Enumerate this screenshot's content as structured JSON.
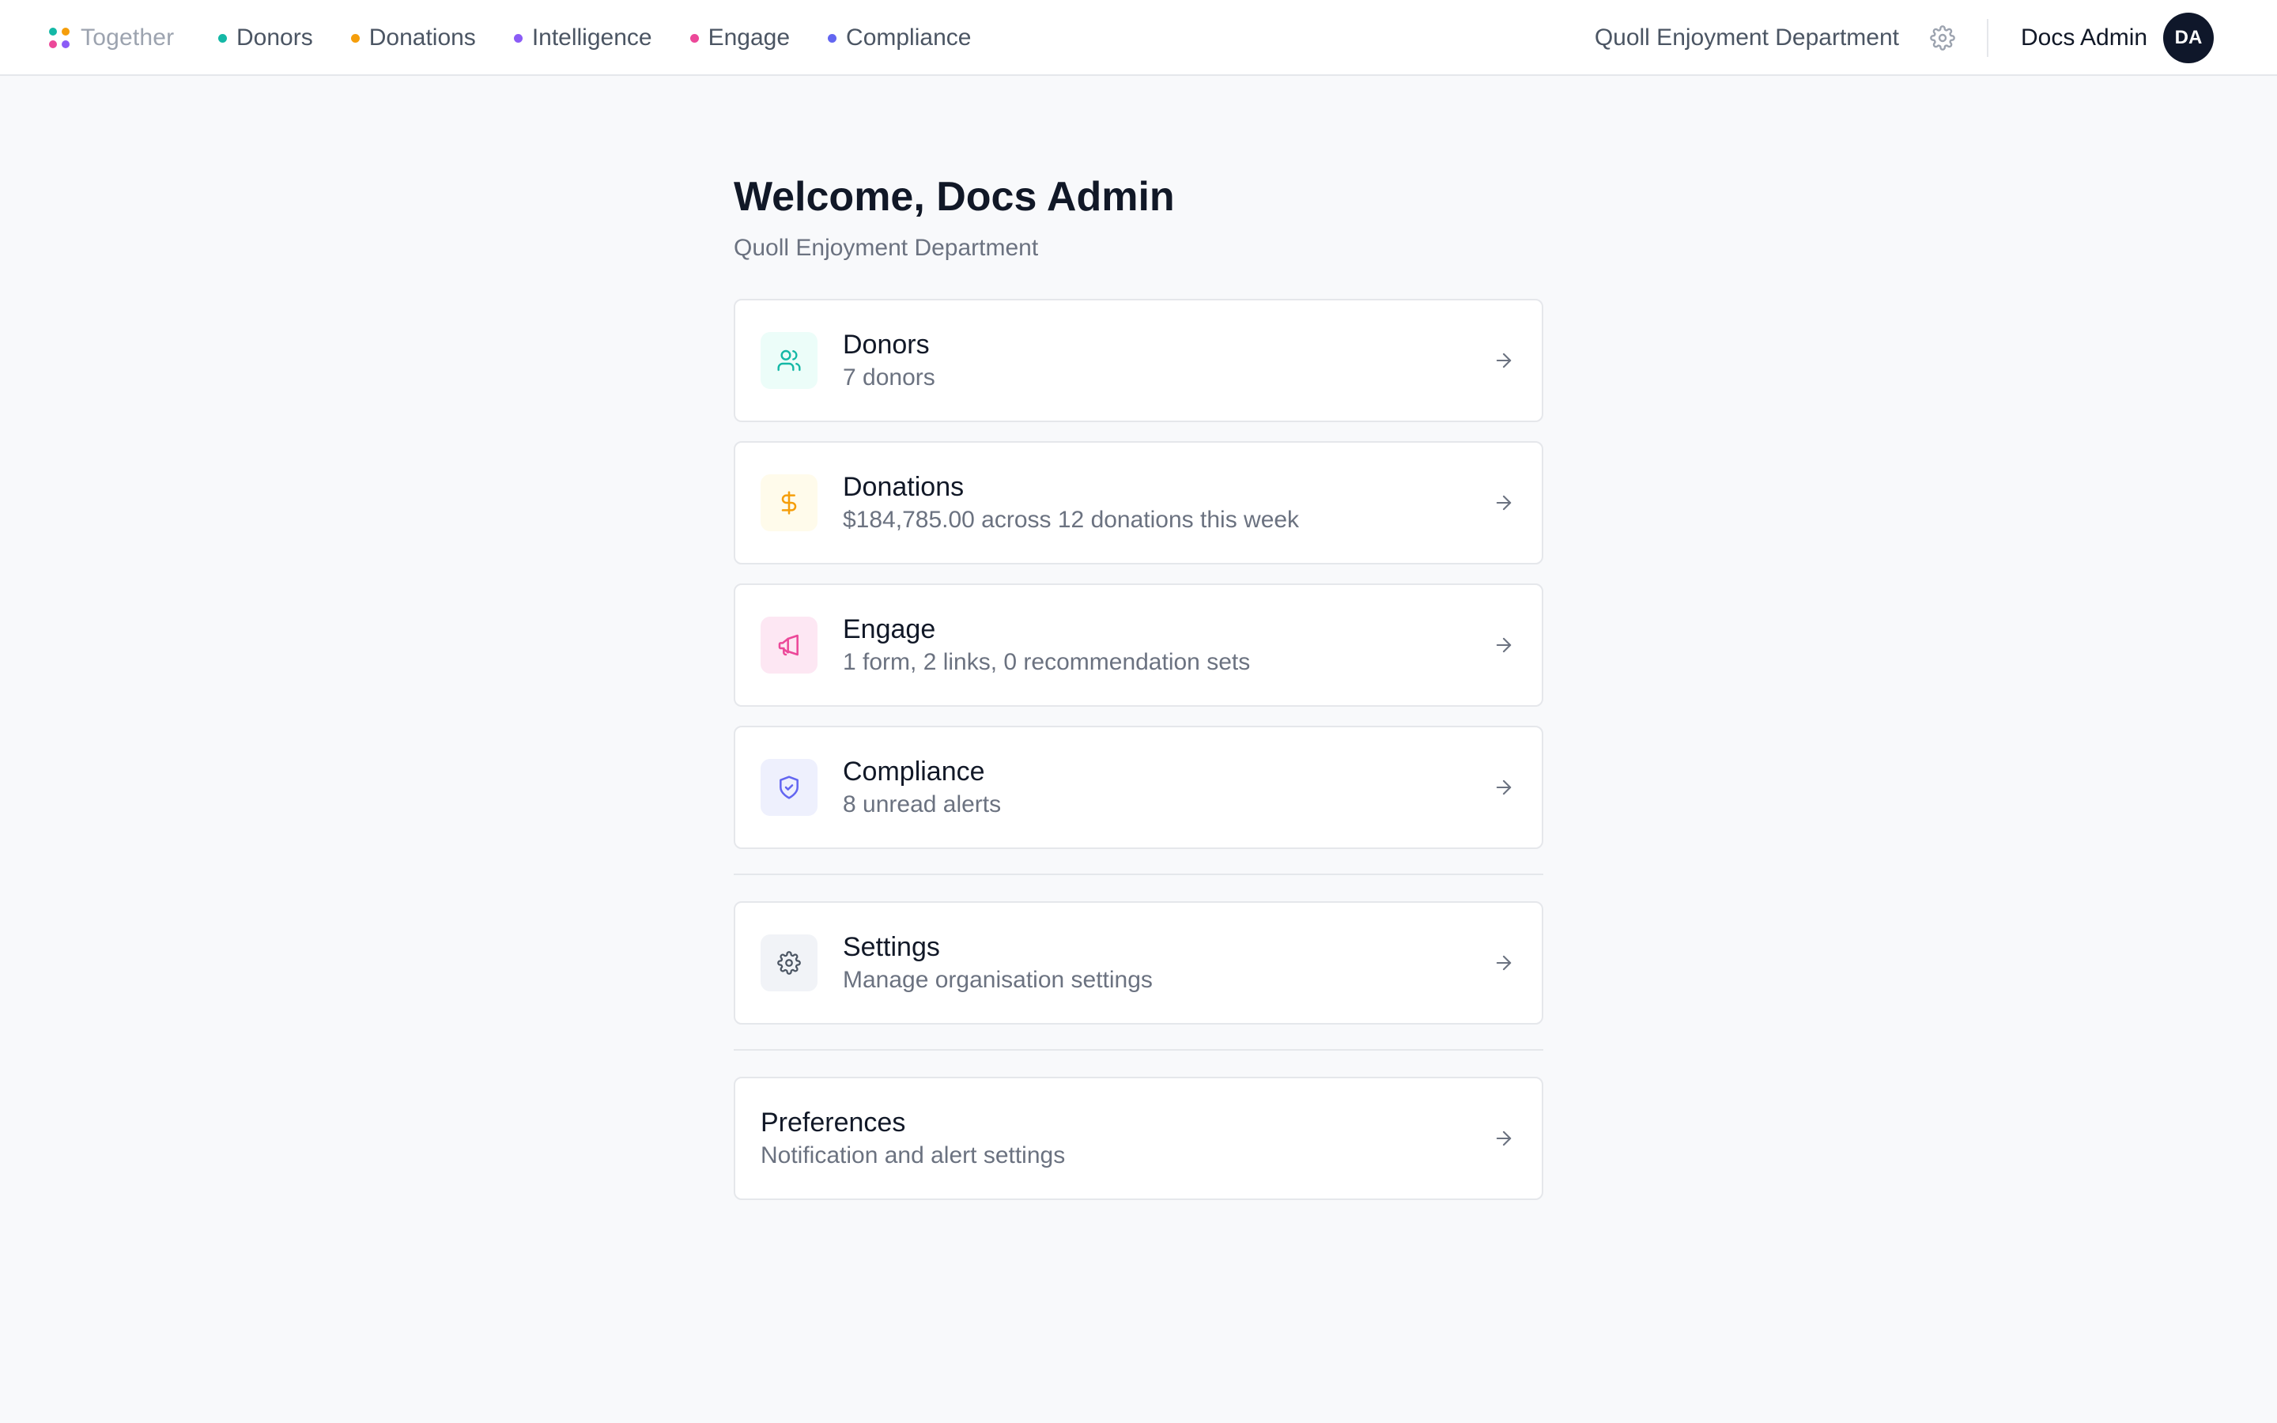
{
  "nav": {
    "brand": "Together",
    "brand_dot_colors": [
      "#14b8a6",
      "#f59e0b",
      "#ec4899",
      "#8b5cf6"
    ],
    "links": [
      {
        "label": "Donors",
        "color": "#14b8a6"
      },
      {
        "label": "Donations",
        "color": "#f59e0b"
      },
      {
        "label": "Intelligence",
        "color": "#8b5cf6"
      },
      {
        "label": "Engage",
        "color": "#ec4899"
      },
      {
        "label": "Compliance",
        "color": "#6366f1"
      }
    ],
    "org_name": "Quoll Enjoyment Department",
    "settings_icon": "gear-icon",
    "user_name": "Docs Admin",
    "avatar_initials": "DA"
  },
  "main": {
    "welcome": "Welcome, Docs Admin",
    "subtitle": "Quoll Enjoyment Department"
  },
  "cards": [
    {
      "title": "Donors",
      "desc": "7 donors",
      "icon": "users-icon",
      "icon_color": "#14b8a6",
      "icon_bg": "#ecfdf9"
    },
    {
      "title": "Donations",
      "desc": "$184,785.00 across 12 donations this week",
      "icon": "dollar-icon",
      "icon_color": "#f59e0b",
      "icon_bg": "#fffbeb"
    },
    {
      "title": "Engage",
      "desc": "1 form, 2 links, 0 recommendation sets",
      "icon": "megaphone-icon",
      "icon_color": "#ec4899",
      "icon_bg": "#fde7f3"
    },
    {
      "title": "Compliance",
      "desc": "8 unread alerts",
      "icon": "shield-check-icon",
      "icon_color": "#6366f1",
      "icon_bg": "#eef0fd"
    }
  ],
  "settings_card": {
    "title": "Settings",
    "desc": "Manage organisation settings",
    "icon": "gear-icon",
    "icon_color": "#4b5563",
    "icon_bg": "#f1f3f7"
  },
  "preferences_card": {
    "title": "Preferences",
    "desc": "Notification and alert settings"
  }
}
